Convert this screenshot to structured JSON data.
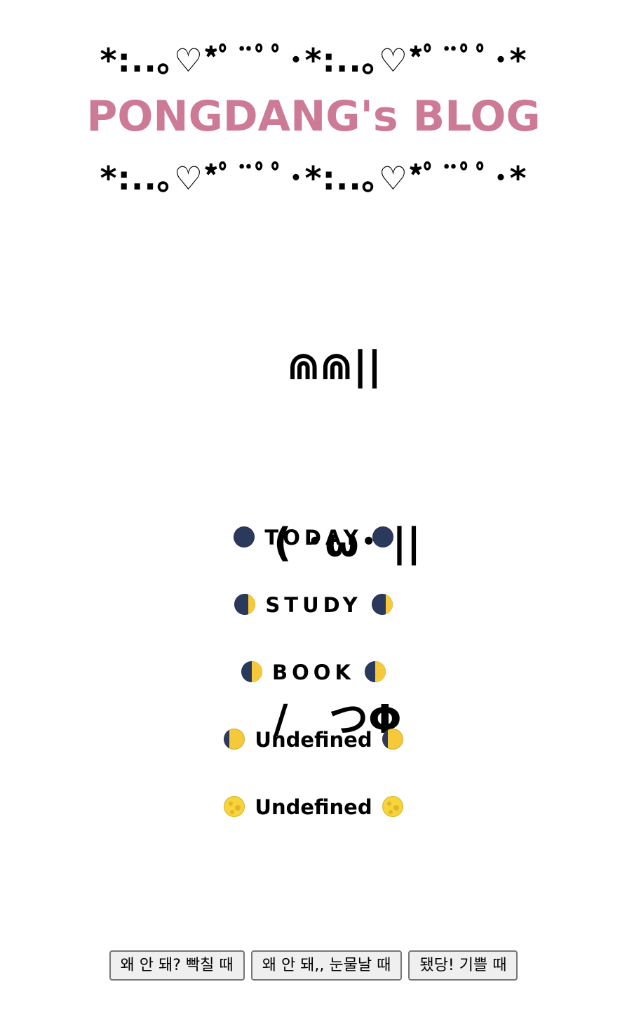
{
  "header": {
    "decoration_top": "*:..｡♡*ﾟ¨ﾟﾟ･*:..｡♡*ﾟ¨ﾟﾟ･*",
    "title": "PONGDANG's BLOG",
    "decoration_bottom": "*:..｡♡*ﾟ¨ﾟﾟ･*:..｡♡*ﾟ¨ﾟﾟ･*",
    "title_color": "#cc7a96"
  },
  "mascot": {
    "lines": [
      " ⋒⋒||",
      "( ･ω･ ||",
      "/   つΦ"
    ]
  },
  "nav": {
    "items": [
      {
        "label": "TODAY",
        "icon": "new-moon-icon"
      },
      {
        "label": "STUDY",
        "icon": "waxing-crescent-moon-icon"
      },
      {
        "label": "BOOK",
        "icon": "first-quarter-moon-icon"
      },
      {
        "label": "Undefined",
        "icon": "waxing-gibbous-moon-icon"
      },
      {
        "label": "Undefined",
        "icon": "full-moon-icon"
      }
    ]
  },
  "buttons": {
    "angry_label": "왜 안 돼? 빡칠 때",
    "sad_label": "왜 안 돼,, 눈물날 때",
    "happy_label": "됐당! 기쁠 때"
  }
}
